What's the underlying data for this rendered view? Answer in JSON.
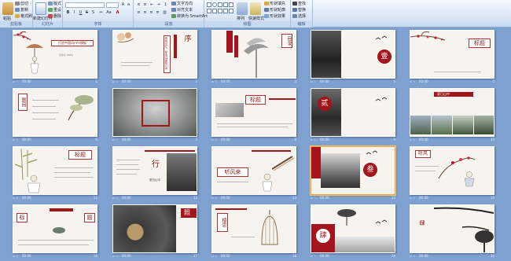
{
  "ribbon": {
    "groups": [
      {
        "label": "剪贴板",
        "name": "clipboard"
      },
      {
        "label": "幻灯片",
        "name": "slides"
      },
      {
        "label": "字体",
        "name": "font"
      },
      {
        "label": "段落",
        "name": "paragraph"
      },
      {
        "label": "绘图",
        "name": "drawing"
      },
      {
        "label": "编辑",
        "name": "editing"
      }
    ],
    "clipboard": {
      "paste": "粘贴",
      "cut": "剪切",
      "copy": "复制",
      "format_painter": "格式刷"
    },
    "slides": {
      "new_slide": "新建幻灯片",
      "layout": "版式",
      "reset": "重设",
      "delete": "删除"
    },
    "font": {
      "font_name": "",
      "font_size": ""
    },
    "paragraph": {
      "text_direction": "文字方向",
      "align_text": "对齐文本",
      "smartart": "转换为 SmartArt"
    },
    "drawing": {
      "arrange": "排列",
      "quick_styles": "快速样式",
      "shape_fill": "形状填充",
      "shape_outline": "形状轮廓",
      "shape_effects": "形状效果"
    },
    "editing": {
      "find": "查找",
      "replace": "替换",
      "select": "选择"
    }
  },
  "slides": [
    {
      "num": "1",
      "time": "00:00",
      "title": "打造中国风PPT模板",
      "subtitle": "分享人 2015"
    },
    {
      "num": "2",
      "time": "00:00",
      "title": "序",
      "vtext": "有些记忆，却永远留在心中"
    },
    {
      "num": "3",
      "time": "00:00",
      "title": "目录"
    },
    {
      "num": "4",
      "time": "00:00",
      "title": "壹"
    },
    {
      "num": "5",
      "time": "00:00",
      "title": "标题"
    },
    {
      "num": "6",
      "time": "00:00",
      "title": "题目"
    },
    {
      "num": "7",
      "time": "00:00",
      "title": ""
    },
    {
      "num": "8",
      "time": "00:00",
      "title": "标题"
    },
    {
      "num": "9",
      "time": "00:00",
      "title": "贰"
    },
    {
      "num": "10",
      "time": "00:00",
      "title": "夏日山中"
    },
    {
      "num": "11",
      "time": "00:00",
      "title": "标题"
    },
    {
      "num": "12",
      "time": "00:00",
      "title": "行",
      "sub": "夏日山中"
    },
    {
      "num": "13",
      "time": "00:00",
      "title": "听风来"
    },
    {
      "num": "14",
      "time": "00:00",
      "title": "叁"
    },
    {
      "num": "15",
      "time": "00:00",
      "title": "听风"
    },
    {
      "num": "16",
      "time": "00:00",
      "title": "标",
      "title2": "题"
    },
    {
      "num": "17",
      "time": "00:00",
      "title": "照"
    },
    {
      "num": "18",
      "time": "00:00",
      "title": "檀思"
    },
    {
      "num": "19",
      "time": "00:00",
      "title": "肆"
    },
    {
      "num": "20",
      "time": "00:00",
      "title": "肆"
    }
  ],
  "colors": {
    "accent_red": "#a3141c",
    "selection": "#f3a13a",
    "background": "#7ea1d0"
  }
}
